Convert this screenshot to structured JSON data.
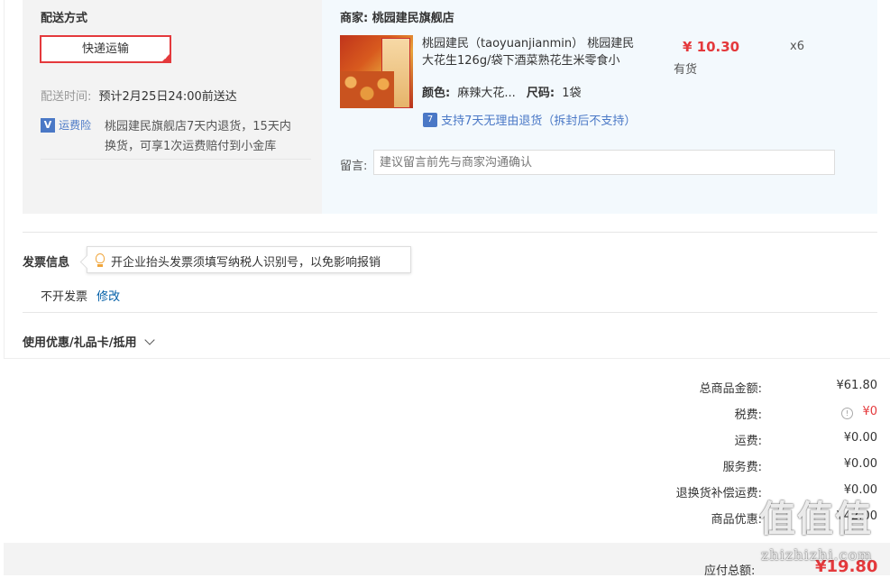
{
  "shipping": {
    "section_title": "配送方式",
    "method_label": "快递运输",
    "delivery_time_label": "配送时间:",
    "delivery_time_value": "预计2月25日24:00前送达",
    "insurance_badge": "运费险",
    "insurance_text_line1": "桃园建民旗舰店7天内退货，15天内",
    "insurance_text_line2": "换货，可享1次运费赔付到小金库"
  },
  "merchant": {
    "label": "商家:",
    "name": "桃园建民旗舰店",
    "product": {
      "title_line1": "桃园建民（taoyuanjianmin） 桃园建民",
      "title_line2": "大花生126g/袋下酒菜熟花生米零食小",
      "price": "¥ 10.30",
      "quantity": "x6",
      "stock": "有货",
      "color_label": "颜色:",
      "color_value": "麻辣大花...",
      "size_label": "尺码:",
      "size_value": "1袋",
      "return_policy": "支持7天无理由退货（拆封后不支持）"
    },
    "remark_label": "留言:",
    "remark_placeholder": "建议留言前先与商家沟通确认"
  },
  "invoice": {
    "title": "发票信息",
    "tip": "开企业抬头发票须填写纳税人识别号，以免影响报销",
    "status": "不开发票",
    "modify_link": "修改"
  },
  "coupon": {
    "title": "使用优惠/礼品卡/抵用"
  },
  "summary": {
    "rows": [
      {
        "label": "总商品金额:",
        "value": "¥61.80"
      },
      {
        "label": "税费:",
        "value": "¥0"
      },
      {
        "label": "运费:",
        "value": "¥0.00"
      },
      {
        "label": "服务费:",
        "value": "¥0.00"
      },
      {
        "label": "退换货补偿运费:",
        "value": "¥0.00"
      },
      {
        "label": "商品优惠:",
        "value": "¥42.00"
      }
    ],
    "total_label": "应付总额:",
    "total_value": "¥19.80"
  },
  "watermark": {
    "text": "zhizhizhi.com"
  },
  "colors": {
    "accent_red": "#e4393c",
    "link_blue": "#005ea7",
    "panel_gray": "#f3f3f3",
    "panel_blue": "#f3f9fd",
    "tax_orange": "#e4393c"
  }
}
